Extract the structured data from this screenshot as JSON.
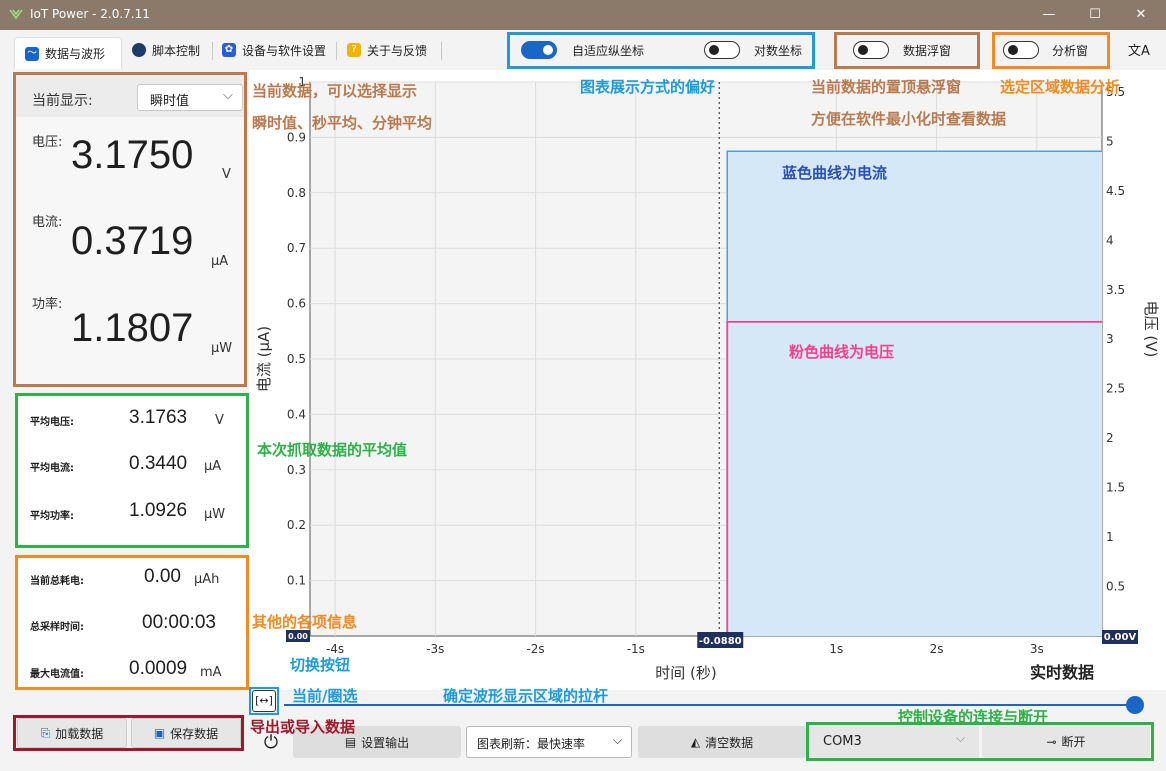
{
  "window": {
    "title": "IoT Power - 2.0.7.11",
    "minimize": "—",
    "maximize": "☐",
    "close": "✕"
  },
  "tabs": [
    {
      "label": "数据与波形",
      "icon": "wave-chart-icon",
      "active": true
    },
    {
      "label": "脚本控制",
      "icon": "script-icon"
    },
    {
      "label": "设备与软件设置",
      "icon": "gear-icon"
    },
    {
      "label": "关于与反馈",
      "icon": "question-icon"
    }
  ],
  "toggles": {
    "adaptive_axis": {
      "label": "自适应纵坐标",
      "on": true
    },
    "log_axis": {
      "label": "对数坐标",
      "on": false
    },
    "data_float": {
      "label": "数据浮窗",
      "on": false
    },
    "analysis": {
      "label": "分析窗",
      "on": false
    }
  },
  "translate_icon": "文A",
  "current": {
    "display_label": "当前显示:",
    "display_select": "瞬时值",
    "voltage_label": "电压:",
    "voltage_value": "3.1750",
    "voltage_unit": "V",
    "current_label": "电流:",
    "current_value": "0.3719",
    "current_unit": "μA",
    "power_label": "功率:",
    "power_value": "1.1807",
    "power_unit": "μW"
  },
  "averages": {
    "v_label": "平均电压:",
    "v_value": "3.1763",
    "v_unit": "V",
    "i_label": "平均电流:",
    "i_value": "0.3440",
    "i_unit": "μA",
    "p_label": "平均功率:",
    "p_value": "1.0926",
    "p_unit": "μW"
  },
  "info": {
    "energy_label": "当前总耗电:",
    "energy_value": "0.00",
    "energy_unit": "μAh",
    "time_label": "总采样时间:",
    "time_value": "00:00:03",
    "max_label": "最大电流值:",
    "max_value": "0.0009",
    "max_unit": "mA"
  },
  "buttons": {
    "load": "加载数据",
    "save": "保存数据",
    "set_output": "设置输出",
    "refresh": "图表刷新：最快速率",
    "clear": "清空数据",
    "port": "COM3",
    "disconnect": "断开",
    "power_icon": "⏻",
    "range_icon": "[↔]"
  },
  "chart": {
    "left_axis_label": "电流 (μA)",
    "right_axis_label": "电压 (V)",
    "x_axis_label": "时间 (秒)",
    "realtime_label": "实时数据",
    "cursor_x": "-0.0880",
    "left_bottom_value": "0.00",
    "right_bottom_value": "0.00V"
  },
  "chart_data": {
    "type": "line",
    "xlabel": "时间 (秒)",
    "ylabel": "电流 (μA)",
    "y2label": "电压 (V)",
    "x_ticks": [
      "-4s",
      "-3s",
      "-2s",
      "-1s",
      "1s",
      "2s",
      "3s"
    ],
    "x_tick_values": [
      -4,
      -3,
      -2,
      -1,
      1,
      2,
      3
    ],
    "xlim": [
      -4.25,
      3.65
    ],
    "y_ticks": [
      "0.1",
      "0.2",
      "0.3",
      "0.4",
      "0.5",
      "0.6",
      "0.7",
      "0.8",
      "0.9",
      "1"
    ],
    "y_tick_values": [
      0.1,
      0.2,
      0.3,
      0.4,
      0.5,
      0.6,
      0.7,
      0.8,
      0.9,
      1.0
    ],
    "ylim": [
      0,
      1.0
    ],
    "y2_ticks": [
      "0.5",
      "1",
      "1.5",
      "2",
      "2.5",
      "3",
      "3.5",
      "4",
      "4.5",
      "5",
      "5.5"
    ],
    "y2_tick_values": [
      0.5,
      1,
      1.5,
      2,
      2.5,
      3,
      3.5,
      4,
      4.5,
      5,
      5.5
    ],
    "y2lim": [
      0,
      5.6
    ],
    "cursor_x": -0.088,
    "series": [
      {
        "name": "电流",
        "color": "#4a9fe0",
        "fill": "#d4e8f7",
        "x": [
          -0.088,
          -0.088,
          3.65
        ],
        "y": [
          0,
          0.875,
          0.875
        ]
      },
      {
        "name": "电压",
        "color": "#ff3d8b",
        "x": [
          -0.088,
          -0.088,
          3.65
        ],
        "y": [
          0,
          3.175,
          3.175
        ],
        "axis": "right"
      }
    ],
    "grid": true
  },
  "annotations": [
    {
      "text": "当前数据，可以选择显示",
      "color": "#b97a4f"
    },
    {
      "text": "瞬时值、秒平均、分钟平均",
      "color": "#b97a4f"
    },
    {
      "text": "图表展示方式的偏好",
      "color": "#1e9bd8"
    },
    {
      "text": "当前数据的置顶悬浮窗",
      "color": "#b97a4f"
    },
    {
      "text": "方便在软件最小化时查看数据",
      "color": "#b97a4f"
    },
    {
      "text": "选定区域数据分析",
      "color": "#f28b22"
    },
    {
      "text": "蓝色曲线为电流",
      "color": "#2b4fb8"
    },
    {
      "text": "粉色曲线为电压",
      "color": "#ff3d8b"
    },
    {
      "text": "本次抓取数据的平均值",
      "color": "#2fb14a"
    },
    {
      "text": "其他的各项信息",
      "color": "#f28b22"
    },
    {
      "text": "切换按钮",
      "color": "#1e9bd8"
    },
    {
      "text": "当前/圈选",
      "color": "#1e9bd8"
    },
    {
      "text": "确定波形显示区域的拉杆",
      "color": "#1e9bd8"
    },
    {
      "text": "导出或导入数据",
      "color": "#a0182a"
    },
    {
      "text": "控制设备的连接与断开",
      "color": "#2fb14a"
    }
  ]
}
